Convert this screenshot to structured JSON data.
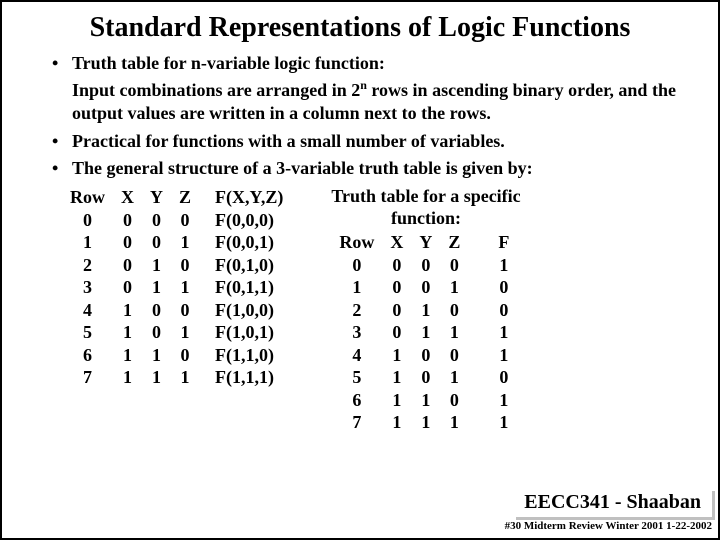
{
  "title": "Standard Representations of Logic Functions",
  "bullet1": "Truth table for n-variable logic function:",
  "indent1a": "Input combinations are arranged in 2",
  "indent1_sup": "n",
  "indent1b": " rows in ascending binary order, and the output values are written in a column next to the rows.",
  "bullet2": "Practical for functions with a small number of variables.",
  "bullet3": "The general structure of a 3-variable truth table is given by:",
  "table1": {
    "head": {
      "row": "Row",
      "x": "X",
      "y": "Y",
      "z": "Z",
      "f": "F(X,Y,Z)"
    },
    "rows": [
      {
        "r": "0",
        "x": "0",
        "y": "0",
        "z": "0",
        "f": "F(0,0,0)"
      },
      {
        "r": "1",
        "x": "0",
        "y": "0",
        "z": "1",
        "f": "F(0,0,1)"
      },
      {
        "r": "2",
        "x": "0",
        "y": "1",
        "z": "0",
        "f": "F(0,1,0)"
      },
      {
        "r": "3",
        "x": "0",
        "y": "1",
        "z": "1",
        "f": "F(0,1,1)"
      },
      {
        "r": "4",
        "x": "1",
        "y": "0",
        "z": "0",
        "f": "F(1,0,0)"
      },
      {
        "r": "5",
        "x": "1",
        "y": "0",
        "z": "1",
        "f": "F(1,0,1)"
      },
      {
        "r": "6",
        "x": "1",
        "y": "1",
        "z": "0",
        "f": "F(1,1,0)"
      },
      {
        "r": "7",
        "x": "1",
        "y": "1",
        "z": "1",
        "f": "F(1,1,1)"
      }
    ]
  },
  "table2": {
    "title_line1": "Truth table for a specific",
    "title_line2": "function:",
    "head": {
      "row": "Row",
      "x": "X",
      "y": "Y",
      "z": "Z",
      "f": "F"
    },
    "rows": [
      {
        "r": "0",
        "x": "0",
        "y": "0",
        "z": "0",
        "f": "1"
      },
      {
        "r": "1",
        "x": "0",
        "y": "0",
        "z": "1",
        "f": "0"
      },
      {
        "r": "2",
        "x": "0",
        "y": "1",
        "z": "0",
        "f": "0"
      },
      {
        "r": "3",
        "x": "0",
        "y": "1",
        "z": "1",
        "f": "1"
      },
      {
        "r": "4",
        "x": "1",
        "y": "0",
        "z": "0",
        "f": "1"
      },
      {
        "r": "5",
        "x": "1",
        "y": "0",
        "z": "1",
        "f": "0"
      },
      {
        "r": "6",
        "x": "1",
        "y": "1",
        "z": "0",
        "f": "1"
      },
      {
        "r": "7",
        "x": "1",
        "y": "1",
        "z": "1",
        "f": "1"
      }
    ]
  },
  "footer": {
    "course": "EECC341 - Shaaban",
    "page": "#30  Midterm Review  Winter 2001  1-22-2002"
  }
}
